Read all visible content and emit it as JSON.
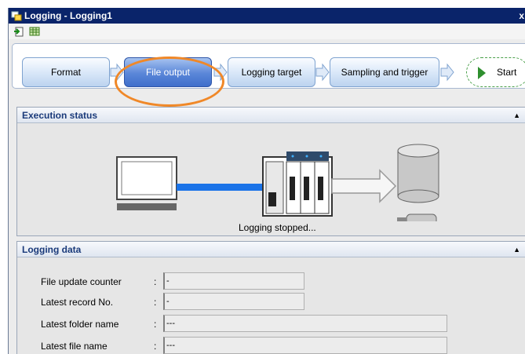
{
  "window": {
    "title": "Logging - Logging1",
    "close_glyph": "x"
  },
  "toolbar": {
    "icons": [
      "import-icon",
      "table-icon"
    ]
  },
  "wizard": {
    "steps": [
      {
        "label": "Format"
      },
      {
        "label": "File output"
      },
      {
        "label": "Logging target"
      },
      {
        "label": "Sampling and trigger"
      }
    ],
    "start_label": "Start",
    "active_step": "File output"
  },
  "execution_status": {
    "header": "Execution status",
    "collapse_glyph": "▲",
    "status_text": "Logging stopped..."
  },
  "logging_data": {
    "header": "Logging data",
    "collapse_glyph": "▲",
    "rows": [
      {
        "label": "File update counter",
        "value": "-"
      },
      {
        "label": "Latest record No.",
        "value": "-"
      },
      {
        "label": "Latest folder name",
        "value": "---"
      },
      {
        "label": "Latest file name",
        "value": "---"
      }
    ]
  },
  "colors": {
    "title_bar": "#0a246a",
    "active_step": "#4a78d2",
    "highlight_ring": "#f08828",
    "connection_line": "#1a73e8",
    "start_play": "#2f8f2f"
  }
}
